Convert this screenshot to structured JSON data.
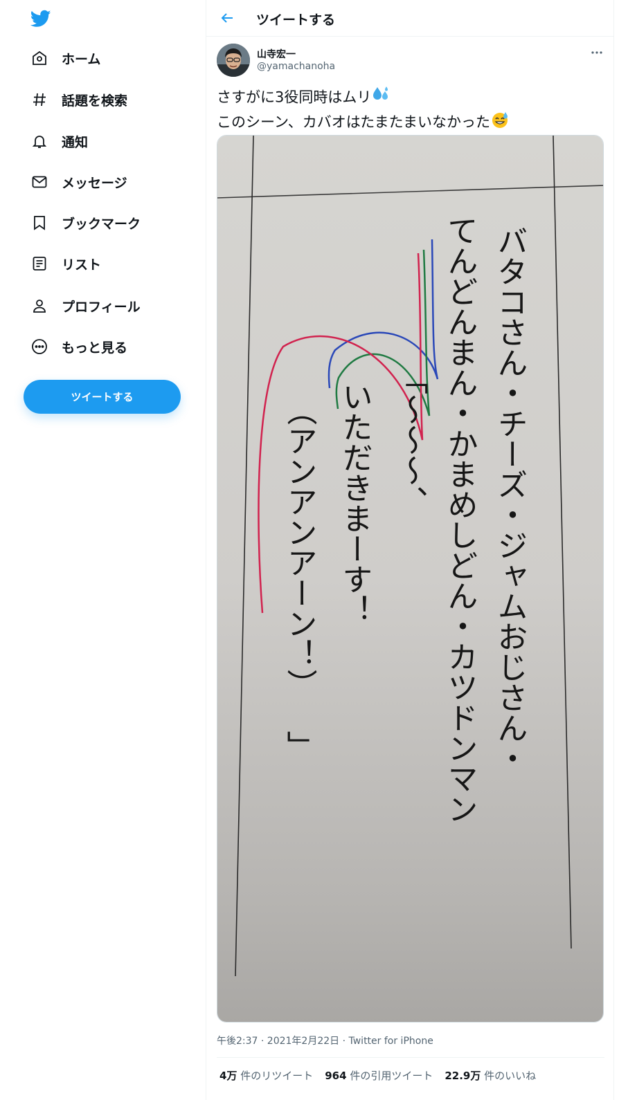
{
  "sidebar": {
    "logo": "twitter-bird-icon",
    "nav": [
      {
        "label": "ホーム",
        "icon": "home-icon"
      },
      {
        "label": "話題を検索",
        "icon": "hashtag-icon"
      },
      {
        "label": "通知",
        "icon": "bell-icon"
      },
      {
        "label": "メッセージ",
        "icon": "mail-icon"
      },
      {
        "label": "ブックマーク",
        "icon": "bookmark-icon"
      },
      {
        "label": "リスト",
        "icon": "list-icon"
      },
      {
        "label": "プロフィール",
        "icon": "person-icon"
      },
      {
        "label": "もっと見る",
        "icon": "more-circle-icon"
      }
    ],
    "tweet_button": "ツイートする"
  },
  "header": {
    "title": "ツイートする"
  },
  "tweet": {
    "author_name": "山寺宏一",
    "author_handle": "@yamachanoha",
    "text_line1": "さすがに3役同時はムリ",
    "text_line2": "このシーン、カバオはたまたまいなかった",
    "emoji1": "sweat-droplets-emoji",
    "emoji2": "grinning-sweat-emoji",
    "photo": {
      "col1": "バタコさん・チーズ・ジャムおじさん・",
      "col2": "てんどんまん・かまめしどん・カツドンマン",
      "col3": "「〜〜〜、",
      "col4": "いただきまーす！",
      "col5": "（アンアンアーン！）",
      "col6": "」"
    },
    "meta": "午後2:37 · 2021年2月22日 · Twitter for iPhone",
    "stats": {
      "retweets_count": "4万",
      "retweets_label": "件のリツイート",
      "quotes_count": "964",
      "quotes_label": "件の引用ツイート",
      "likes_count": "22.9万",
      "likes_label": "件のいいね"
    }
  },
  "colors": {
    "accent": "#1d9bf0",
    "text": "#0f1419",
    "muted": "#536471"
  }
}
